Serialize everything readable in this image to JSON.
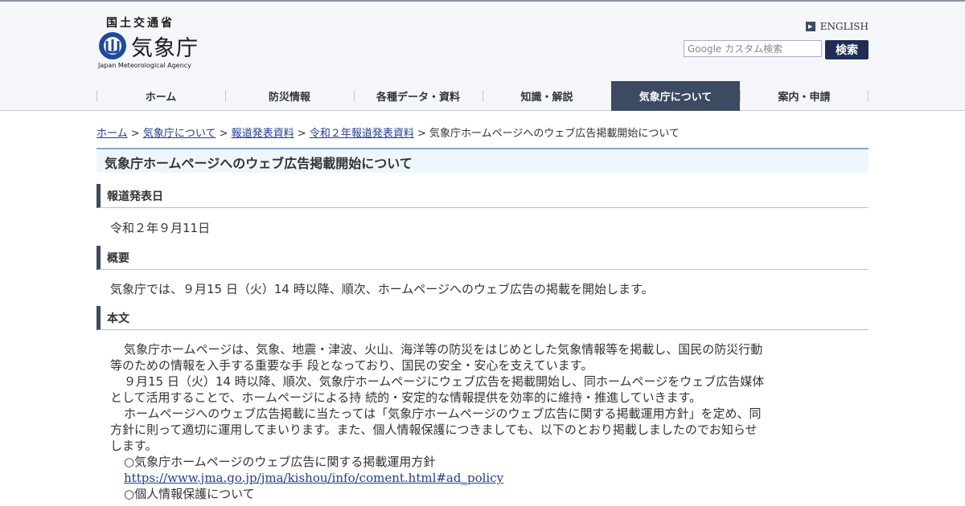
{
  "header": {
    "ministry": "国土交通省",
    "logo_jp": "気象庁",
    "logo_en": "Japan Meteorological Agency",
    "english_link": "ENGLISH",
    "search_placeholder": "Google カスタム検索",
    "search_button": "検索"
  },
  "nav": [
    {
      "label": "ホーム"
    },
    {
      "label": "防災情報"
    },
    {
      "label": "各種データ・資料"
    },
    {
      "label": "知識・解説"
    },
    {
      "label": "気象庁について",
      "active": true
    },
    {
      "label": "案内・申請"
    }
  ],
  "breadcrumb": {
    "items": [
      "ホーム",
      "気象庁について",
      "報道発表資料",
      "令和２年報道発表資料"
    ],
    "separator": ">",
    "current": "気象庁ホームページへのウェブ広告掲載開始について"
  },
  "page_title": "気象庁ホームページへのウェブ広告掲載開始について",
  "sections": {
    "date": {
      "heading": "報道発表日",
      "text": "令和２年９月11日"
    },
    "summary": {
      "heading": "概要",
      "text": "気象庁では、９月15 日（火）14 時以降、順次、ホームページへのウェブ広告の掲載を開始します。"
    },
    "body": {
      "heading": "本文",
      "lines": [
        "気象庁ホームページは、気象、地震・津波、火山、海洋等の防災をはじめとした気象情報等を掲載し、国民の防災行動",
        "等のための情報を入手する重要な手 段となっており、国民の安全・安心を支えています。",
        "９月15 日（火）14 時以降、順次、気象庁ホームページにウェブ広告を掲載開始し、同ホームページをウェブ広告媒体",
        "として活用することで、ホームページによる持 続的・安定的な情報提供を効率的に維持・推進していきます。",
        "ホームページへのウェブ広告掲載に当たっては「気象庁ホームページのウェブ広告に関する掲載運用方針」を定め、同",
        "方針に則って適切に運用してまいります。また、個人情報保護につきましても、以下のとおり掲載しましたのでお知らせ",
        "します。",
        "○気象庁ホームページのウェブ広告に関する掲載運用方針"
      ],
      "link": "https://www.jma.go.jp/jma/kishou/info/coment.html#ad_policy",
      "after_link": "○個人情報保護について"
    }
  },
  "colors": {
    "nav_active": "#3c4a62",
    "link": "#1f3c99",
    "search_button": "#1e2d54",
    "title_bg": "#eef6fd"
  }
}
